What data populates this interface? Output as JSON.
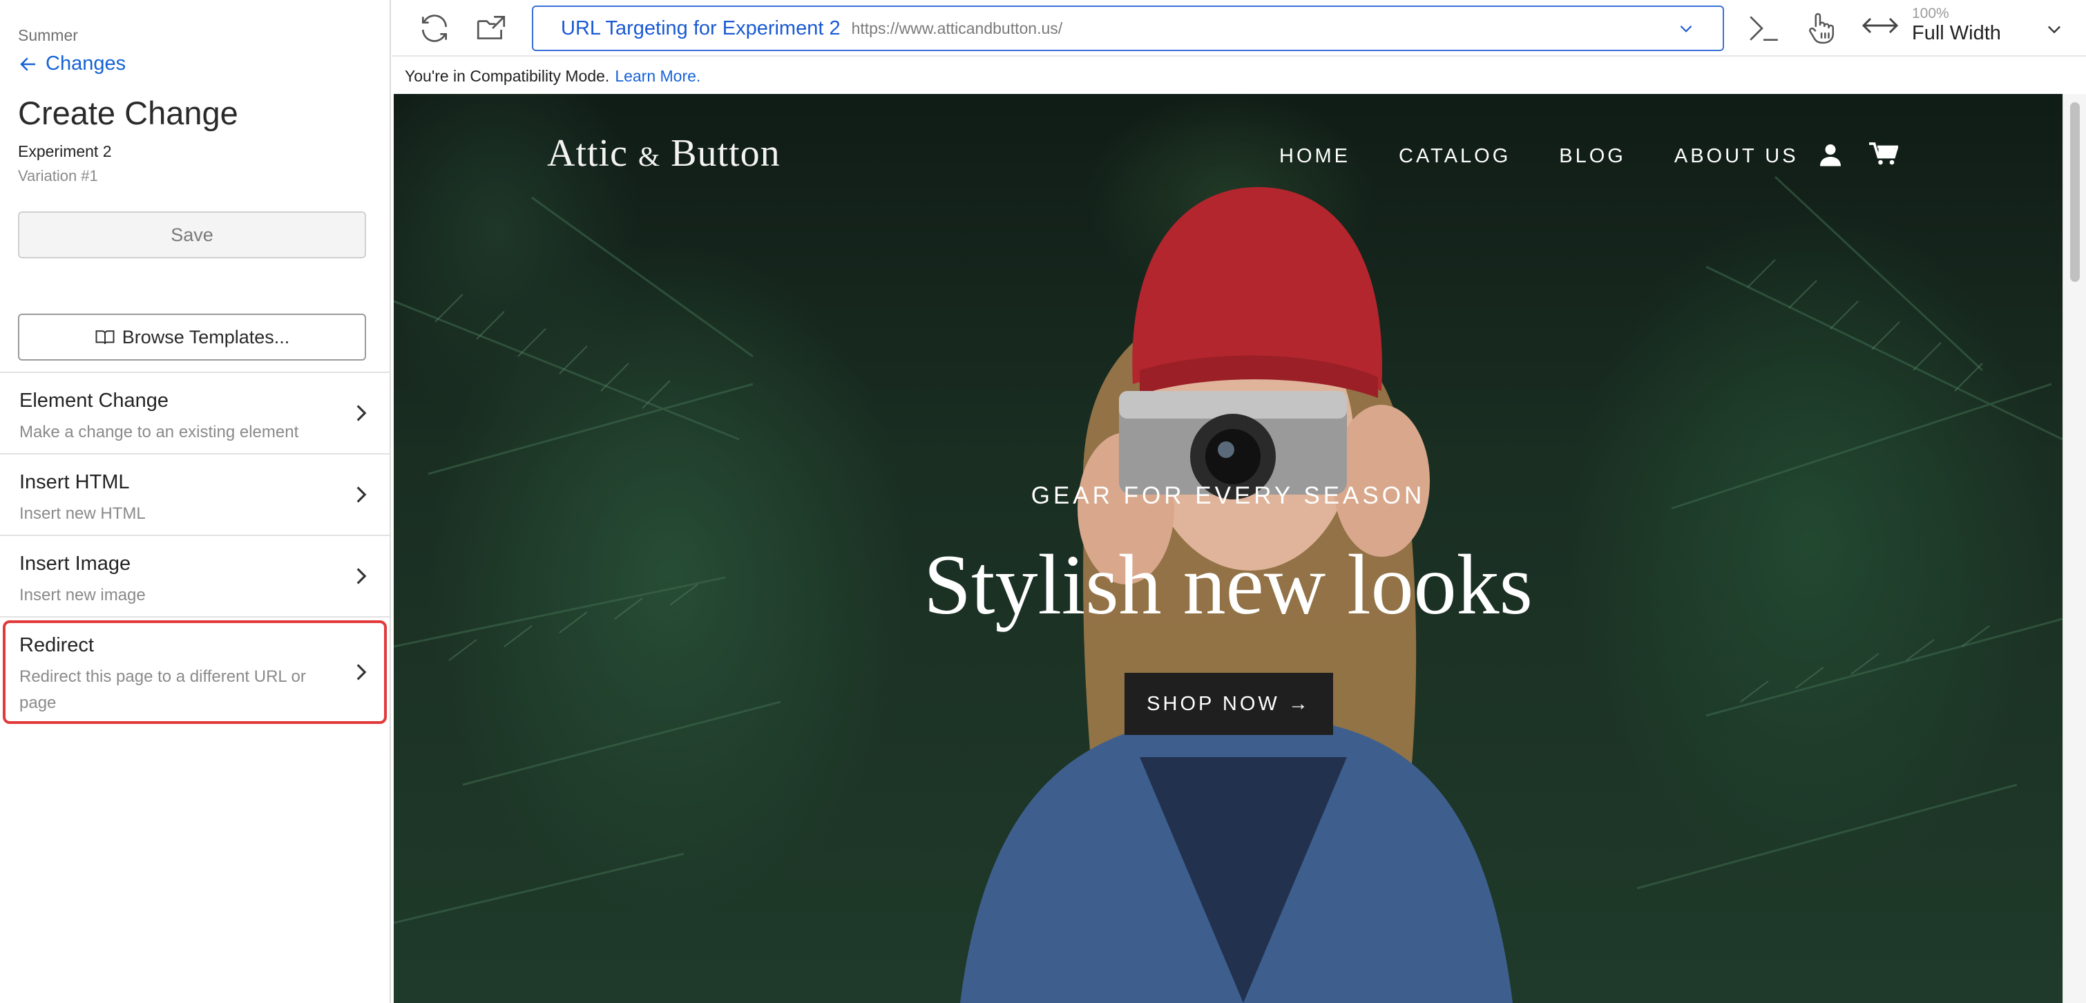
{
  "sidebar": {
    "breadcrumb": "Summer",
    "back_label": "Changes",
    "title": "Create Change",
    "experiment": "Experiment 2",
    "variation": "Variation #1",
    "save_label": "Save",
    "browse_label": "Browse Templates...",
    "items": [
      {
        "title": "Element Change",
        "desc": "Make a change to an existing element"
      },
      {
        "title": "Insert HTML",
        "desc": "Insert new HTML"
      },
      {
        "title": "Insert Image",
        "desc": "Insert new image"
      },
      {
        "title": "Redirect",
        "desc": "Redirect this page to a different URL or page"
      }
    ]
  },
  "toolbar": {
    "url_label": "URL Targeting for Experiment 2",
    "url_value": "https://www.atticandbutton.us/",
    "zoom_percent": "100%",
    "zoom_label": "Full Width"
  },
  "compat": {
    "message": "You're in Compatibility Mode.",
    "link": "Learn More."
  },
  "site": {
    "logo_main": "Attic ",
    "logo_amp": "&",
    "logo_end": " Button",
    "nav": [
      "HOME",
      "CATALOG",
      "BLOG",
      "ABOUT US"
    ],
    "kicker": "GEAR FOR EVERY SEASON",
    "headline": "Stylish new looks",
    "cta": "SHOP NOW →"
  },
  "colors": {
    "accent": "#1562d6",
    "selected_outline": "#e23a3a"
  }
}
